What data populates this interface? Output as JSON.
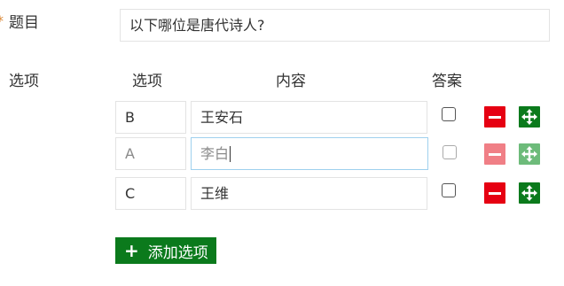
{
  "question": {
    "required_mark": "*",
    "label": "题目",
    "value": "以下哪位是唐代诗人?"
  },
  "options": {
    "label": "选项",
    "columns": {
      "option": "选项",
      "content": "内容",
      "answer": "答案"
    },
    "rows": [
      {
        "key": "B",
        "content": "王安石",
        "checked": false,
        "dragging": false
      },
      {
        "key": "A",
        "content": "李白",
        "checked": false,
        "dragging": true
      },
      {
        "key": "C",
        "content": "王维",
        "checked": false,
        "dragging": false
      }
    ],
    "add_label": "添加选项"
  },
  "icons": {
    "remove": "minus-icon",
    "move": "move-arrows-icon",
    "add": "plus-icon"
  },
  "colors": {
    "remove": "#e60012",
    "move": "#0b7a1c",
    "add_button": "#0b7a1c",
    "focus_border": "#9fd0ee"
  }
}
